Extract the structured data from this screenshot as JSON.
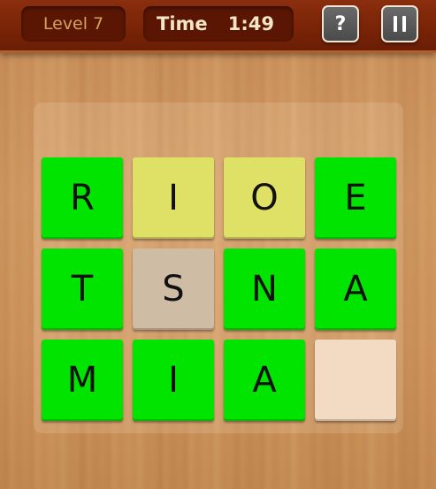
{
  "header": {
    "level_label": "Level 7",
    "time_label": "Time",
    "time_value": "1:49",
    "help_label": "?"
  },
  "colors": {
    "correct": "#00e400",
    "misplaced": "#dfe066",
    "selected": "#cebca5",
    "empty": "#f3dbc3",
    "topbar": "#7a2407"
  },
  "grid": [
    [
      {
        "letter": "R",
        "state": "correct"
      },
      {
        "letter": "I",
        "state": "misplaced"
      },
      {
        "letter": "O",
        "state": "misplaced"
      },
      {
        "letter": "E",
        "state": "correct"
      }
    ],
    [
      {
        "letter": "T",
        "state": "correct"
      },
      {
        "letter": "S",
        "state": "selected"
      },
      {
        "letter": "N",
        "state": "correct"
      },
      {
        "letter": "A",
        "state": "correct"
      }
    ],
    [
      {
        "letter": "M",
        "state": "correct"
      },
      {
        "letter": "I",
        "state": "correct"
      },
      {
        "letter": "A",
        "state": "correct"
      },
      {
        "letter": "",
        "state": "empty"
      }
    ]
  ]
}
